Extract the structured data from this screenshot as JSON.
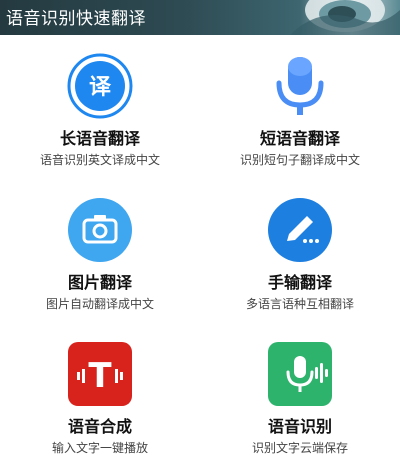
{
  "banner": {
    "title": "语音识别快速翻译"
  },
  "features": [
    {
      "title": "长语音翻译",
      "subtitle": "语音识别英文译成中文",
      "icon": "translate-icon",
      "icon_text": "译",
      "color": "#1e88f0"
    },
    {
      "title": "短语音翻译",
      "subtitle": "识别短句子翻译成中文",
      "icon": "microphone-icon",
      "color": "#4a8ef5"
    },
    {
      "title": "图片翻译",
      "subtitle": "图片自动翻译成中文",
      "icon": "camera-icon",
      "color": "#3fa6f0"
    },
    {
      "title": "手输翻译",
      "subtitle": "多语言语种互相翻译",
      "icon": "pencil-icon",
      "color": "#1d7fe0"
    },
    {
      "title": "语音合成",
      "subtitle": "输入文字一键播放",
      "icon": "text-to-speech-icon",
      "icon_text": "T",
      "color": "#d7231b"
    },
    {
      "title": "语音识别",
      "subtitle": "识别文字云端保存",
      "icon": "voice-recognition-icon",
      "color": "#2eb36c"
    }
  ]
}
